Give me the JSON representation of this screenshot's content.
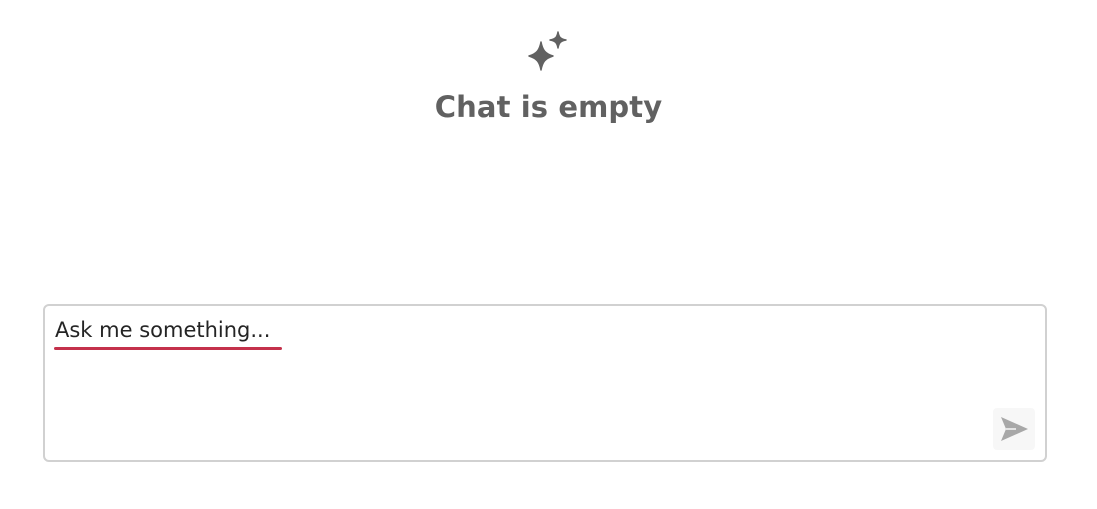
{
  "empty_state": {
    "icon": "sparkle-icon",
    "title": "Chat is empty"
  },
  "composer": {
    "text": "Ask me something...",
    "send_icon": "send-icon"
  },
  "colors": {
    "title_text": "#616161",
    "icon": "#616161",
    "composer_border": "#d1d1d1",
    "spell_underline": "#c4314b",
    "send_icon": "#a8a8a8"
  }
}
